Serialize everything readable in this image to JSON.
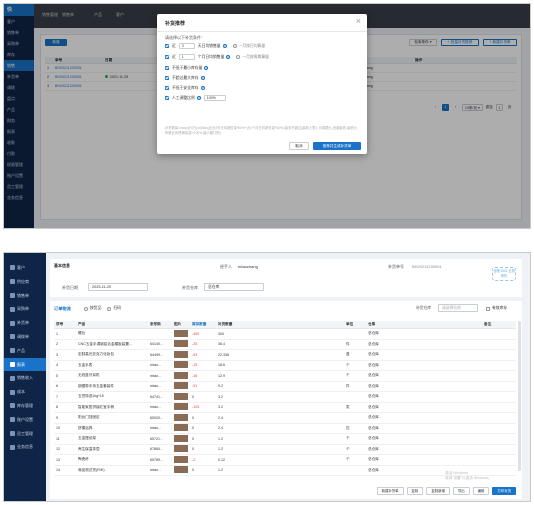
{
  "top": {
    "logo": "快",
    "nav": [
      "客户",
      "销售单",
      "采购单",
      "库存",
      "销售",
      "补货单",
      "调拨",
      "盘点",
      "产品",
      "财务",
      "报表",
      "收款",
      "付款",
      "权限管理",
      "账户设置",
      "员工管理",
      "业务信息"
    ],
    "active_nav_index": 4,
    "tabs": [
      "销售管理",
      "销售单",
      "产品",
      "客户"
    ],
    "toolbar": {
      "primary": "新增",
      "filter": "检索条件 ▾",
      "btn1": "+ 批量补货推荐",
      "btn2": "+ 新建补货单"
    },
    "table": {
      "headers": [
        "",
        "单号",
        "日期",
        "",
        "",
        "",
        "经手人",
        "操作"
      ],
      "rows": [
        [
          "1",
          "BH20211230001",
          "",
          "",
          "",
          "",
          "mtaochang",
          ""
        ],
        [
          "2",
          "BH20211230001",
          "2021-11-29",
          "",
          "",
          "",
          "mtaochang",
          ""
        ],
        [
          "3",
          "BH20211230001",
          "",
          "",
          "",
          "",
          "mtaochang",
          ""
        ]
      ]
    },
    "pager": [
      "‹",
      "1",
      "›",
      "10条/页 ▾",
      "跳至",
      "1",
      "页"
    ],
    "modal": {
      "title": "补货推荐",
      "condition_label": "请选择以下补货条件：",
      "rows": [
        {
          "pre": "近",
          "num": "3",
          "text": "天日均销售量"
        },
        {
          "pre": "近",
          "num": "1",
          "text": "个月日均销售量"
        },
        {
          "text": "不低于最小库存量"
        },
        {
          "text": "不超过最大库存"
        },
        {
          "text": "不低于安全库存"
        },
        {
          "text": "人工调整比例",
          "num": "100%"
        }
      ],
      "radio_1": "一月按日均算量",
      "radio_2": "一月按周期算量",
      "note": "补货数量=max(近X日(or)Max(近近3天日均销售量*60%+近1个月日均销售量*60%),最多不超过(最新上限), 可调整比-但超最低-最低价所格比所得销量量)*100%,最小额订购)",
      "cancel": "取消",
      "confirm": "推荐并生成补货单"
    }
  },
  "bottom": {
    "logo": "",
    "nav": [
      "客户",
      "供应商",
      "销售单",
      "采购单",
      "补货单",
      "调拨单",
      "产品",
      "报表",
      "销售收入",
      "成本",
      "库存管理",
      "账户设置",
      "员工管理",
      "业务信息"
    ],
    "active_nav_index": 7,
    "section_title": "基本信息",
    "handler_label": "经手人",
    "handler_value": "mtaochang",
    "order_no_label": "补货单号",
    "order_no_value": "BH20211230001",
    "date_label": "补货日期",
    "date_value": "2025-11-20",
    "warehouse_label": "补货仓库",
    "warehouse_value": "总仓库",
    "stamp": "仓储  2021  业务条件",
    "list_tab": "订单物流",
    "product_radio": "按货品",
    "scan_radio": "扫码",
    "warehouse_filter_label": "补货仓库",
    "warehouse_filter_value": "请选择仓库",
    "stock_checkbox": "有效库存",
    "headers": [
      "序号",
      "产品",
      "条形码",
      "图片",
      "库存数量",
      "补货数量",
      "单位",
      "仓库",
      "备注"
    ],
    "rows": [
      [
        "1",
        "螺丝",
        "",
        "",
        "-400",
        "300",
        "",
        "总仓库"
      ],
      [
        "2",
        "CNC五金手调钢铝合金模板装置...",
        "64140...",
        "",
        "-25",
        "36.4",
        "件",
        "总仓库"
      ],
      [
        "3",
        "定制高光亚克力化妆包",
        "64499...",
        "",
        "-93",
        "22.336",
        "盒",
        "总仓库"
      ],
      [
        "4",
        "五金手表",
        "mtao...",
        "",
        "-15",
        "18.6",
        "个",
        "总仓库"
      ],
      [
        "5",
        "无线蓝牙耳机",
        "mtao...",
        "",
        "-16",
        "12.9",
        "个",
        "总仓库"
      ],
      [
        "6",
        "钢锯带手持五金套装件",
        "mtao...",
        "",
        "-91",
        "9.2",
        "件",
        "总仓库"
      ],
      [
        "7",
        "玉岳特选1kg*18",
        "64741...",
        "",
        "0",
        "3.2",
        "",
        "总仓库"
      ],
      [
        "8",
        "智能家居拼接红宝手柄",
        "mtao...",
        "",
        "-103",
        "3.2",
        "张",
        "总仓库"
      ],
      [
        "9",
        "阳台门挡固定",
        "65920...",
        "",
        "0",
        "2.4",
        "",
        "总仓库"
      ],
      [
        "10",
        "拼模浴具",
        "mtao...",
        "",
        "0",
        "2.4",
        "匹",
        "总仓库"
      ],
      [
        "11",
        "五金摆设架",
        "65721...",
        "",
        "0",
        "1.2",
        "个",
        "总仓库"
      ],
      [
        "12",
        "养生保温茶壶",
        "67884...",
        "",
        "0",
        "1.2",
        "个",
        "总仓库"
      ],
      [
        "13",
        "陶瓷杯",
        "65789...",
        "",
        "-2",
        "0.12",
        "个",
        "总仓库"
      ],
      [
        "14",
        "商品测试货(FMI)",
        "mtao...",
        "",
        "0",
        "1.2",
        "",
        "总仓库"
      ]
    ],
    "buttons": [
      "新建补货单",
      "复制",
      "复制新增",
      "导出",
      "编辑",
      "打印补货"
    ],
    "watermark_1": "激活 Windows",
    "watermark_2": "转到\"设置\"以激活 Windows。"
  }
}
